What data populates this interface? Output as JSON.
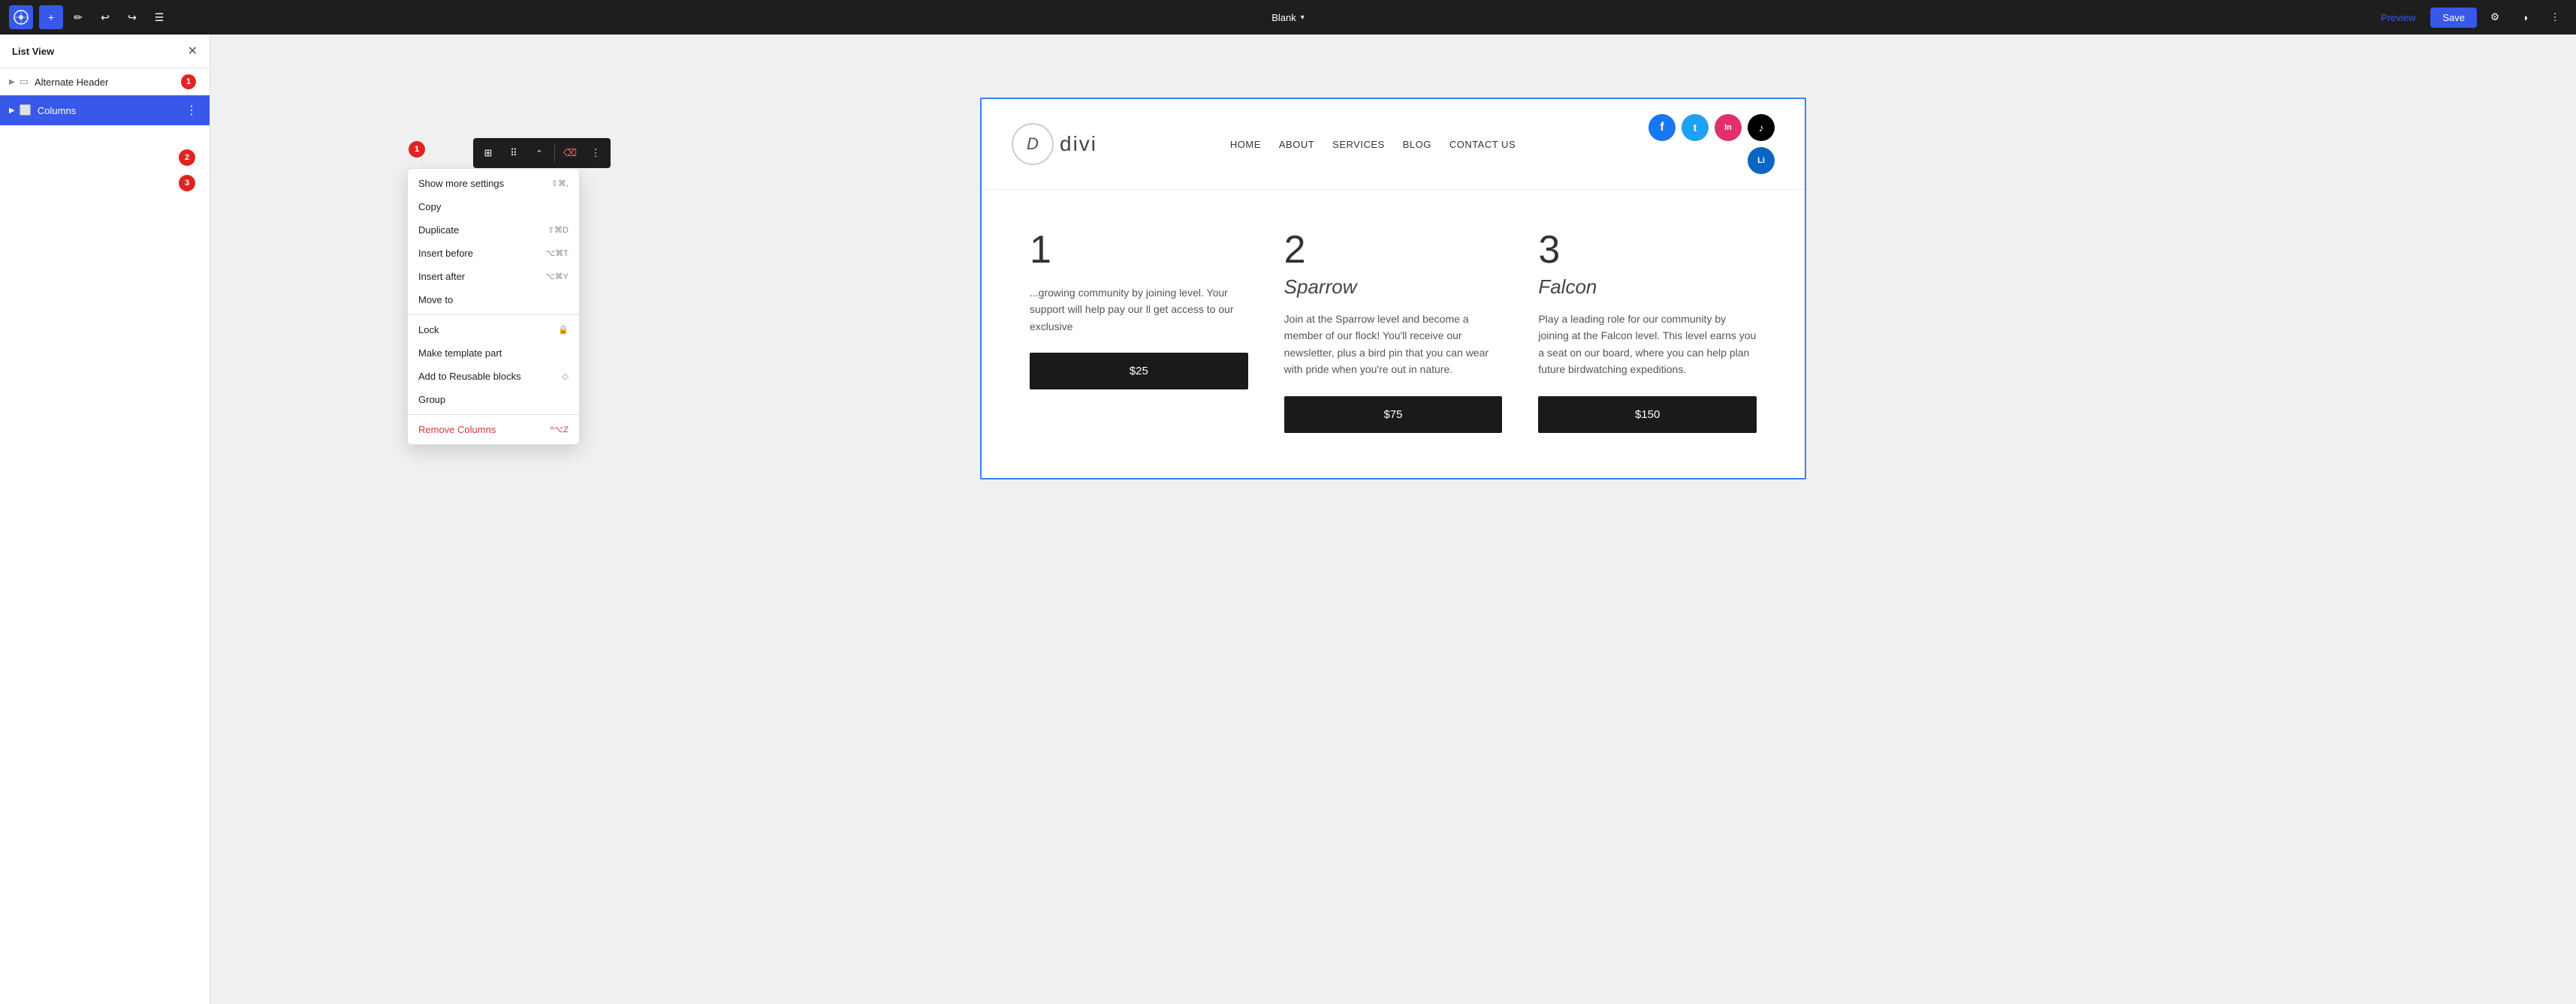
{
  "topbar": {
    "logo": "W",
    "add_label": "+",
    "pencil_icon": "✏",
    "undo_icon": "↩",
    "redo_icon": "↪",
    "list_icon": "☰",
    "doc_title": "Blank",
    "preview_label": "Preview",
    "save_label": "Save",
    "settings_icon": "⚙",
    "contrast_icon": "◑",
    "more_icon": "⋮"
  },
  "sidebar": {
    "title": "List View",
    "items": [
      {
        "id": "alternate-header",
        "label": "Alternate Header",
        "icon": "▭",
        "badge": null,
        "active": false
      },
      {
        "id": "columns",
        "label": "Columns",
        "icon": "⬜",
        "badge": null,
        "active": true
      }
    ],
    "badge1_num": "1",
    "badge2_num": "2",
    "badge3_num": "3"
  },
  "block_toolbar": {
    "columns_icon": "⊞",
    "drag_icon": "⠿",
    "arrow_icon": "⌃",
    "delete_icon": "⌫",
    "more_icon": "⋮"
  },
  "context_menu": {
    "items": [
      {
        "label": "Show more settings",
        "shortcut": "⇧⌘,",
        "icon": null,
        "separator_after": false
      },
      {
        "label": "Copy",
        "shortcut": "",
        "icon": null,
        "separator_after": false
      },
      {
        "label": "Duplicate",
        "shortcut": "⇧⌘D",
        "icon": null,
        "separator_after": false
      },
      {
        "label": "Insert before",
        "shortcut": "⌥⌘T",
        "icon": null,
        "separator_after": false
      },
      {
        "label": "Insert after",
        "shortcut": "⌥⌘Y",
        "icon": null,
        "separator_after": false
      },
      {
        "label": "Move to",
        "shortcut": "",
        "icon": null,
        "separator_after": true
      },
      {
        "label": "Lock",
        "shortcut": "🔒",
        "icon": null,
        "separator_after": false
      },
      {
        "label": "Make template part",
        "shortcut": "",
        "icon": null,
        "separator_after": false
      },
      {
        "label": "Add to Reusable blocks",
        "shortcut": "◇",
        "icon": null,
        "separator_after": false
      },
      {
        "label": "Group",
        "shortcut": "",
        "icon": null,
        "separator_after": true
      },
      {
        "label": "Remove Columns",
        "shortcut": "^⌥Z",
        "icon": null,
        "separator_after": false
      }
    ]
  },
  "site": {
    "logo_letter": "D",
    "logo_text": "divi",
    "nav": [
      "HOME",
      "ABOUT",
      "SERVICES",
      "BLOG",
      "CONTACT US"
    ],
    "social": [
      {
        "name": "facebook",
        "color": "#1877f2",
        "char": "f"
      },
      {
        "name": "twitter",
        "color": "#1da1f2",
        "char": "t"
      },
      {
        "name": "instagram",
        "color": "#e1306c",
        "char": "in"
      },
      {
        "name": "tiktok",
        "color": "#000",
        "char": "♪"
      },
      {
        "name": "linkedin",
        "color": "#0a66c2",
        "char": "Li"
      }
    ]
  },
  "pricing": [
    {
      "num": "1",
      "name": "",
      "desc": "...growing community by joining level. Your support will help pay our ll get access to our exclusive",
      "price": "$25"
    },
    {
      "num": "2",
      "name": "Sparrow",
      "desc": "Join at the Sparrow level and become a member of our flock! You'll receive our newsletter, plus a bird pin that you can wear with pride when you're out in nature.",
      "price": "$75"
    },
    {
      "num": "3",
      "name": "Falcon",
      "desc": "Play a leading role for our community by joining at the Falcon level. This level earns you a seat on our board, where you can help plan future birdwatching expeditions.",
      "price": "$150"
    }
  ]
}
